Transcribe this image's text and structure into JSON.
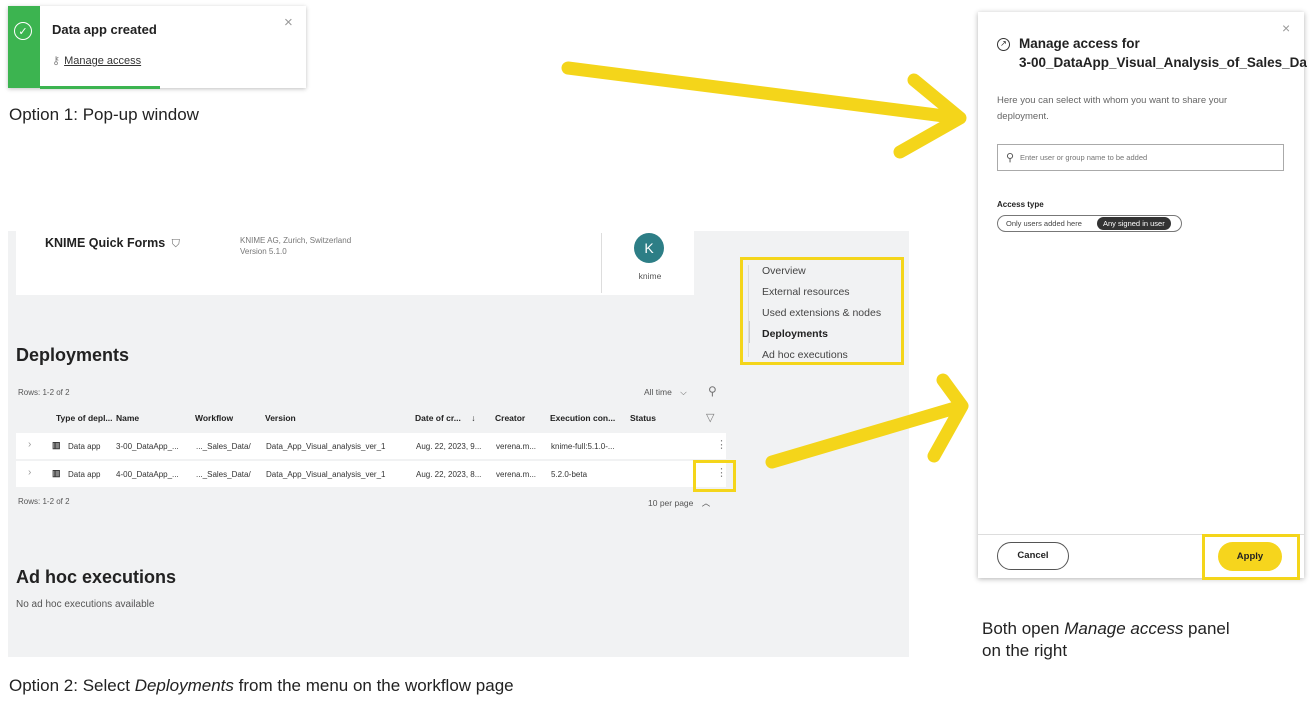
{
  "toast": {
    "title": "Data app created",
    "link": "Manage access",
    "close": "×",
    "success_color": "#3cb450"
  },
  "captions": {
    "option1": "Option 1: Pop-up window",
    "option2_a": "Option 2: Select ",
    "option2_em": "Deployments",
    "option2_b": " from the menu on the workflow page",
    "both_a": "Both open ",
    "both_em": "Manage access",
    "both_b": " panel",
    "both_line2": "on the right"
  },
  "workflow": {
    "title": "KNIME Quick Forms",
    "owner": "KNIME AG, Zurich, Switzerland",
    "version": "Version 5.1.0",
    "avatar_letter": "K",
    "avatar_name": "knime",
    "menu": [
      "Overview",
      "External resources",
      "Used extensions & nodes",
      "Deployments",
      "Ad hoc executions"
    ],
    "deployments": {
      "heading": "Deployments",
      "rows_top": "Rows: 1-2 of 2",
      "rows_bottom": "Rows: 1-2 of 2",
      "time_filter": "All time",
      "per_page": "10 per page",
      "columns": [
        "Type of depl...",
        "Name",
        "Workflow",
        "Version",
        "Date of cr...",
        "Creator",
        "Execution con...",
        "Status"
      ],
      "rows": [
        [
          "Data app",
          "3-00_DataApp_...",
          "..._Sales_Data/",
          "Data_App_Visual_analysis_ver_1",
          "Aug. 22, 2023, 9...",
          "verena.m...",
          "knime-full:5.1.0-...",
          ""
        ],
        [
          "Data app",
          "4-00_DataApp_...",
          "..._Sales_Data/",
          "Data_App_Visual_analysis_ver_1",
          "Aug. 22, 2023, 8...",
          "verena.m...",
          "5.2.0-beta",
          ""
        ]
      ]
    },
    "adhoc": {
      "heading": "Ad hoc executions",
      "empty": "No ad hoc executions available"
    }
  },
  "panel": {
    "title_line1": "Manage access for",
    "title_line2": "3-00_DataApp_Visual_Analysis_of_Sales_Da",
    "description": "Here you can select with whom you want to share your deployment.",
    "search_placeholder": "Enter user or group name to be added",
    "access_type_label": "Access type",
    "access_options": [
      "Only users added here",
      "Any signed in user"
    ],
    "access_selected": "Any signed in user",
    "cancel": "Cancel",
    "apply": "Apply"
  },
  "colors": {
    "highlight": "#f4d51a",
    "apply": "#f6d51d",
    "avatar": "#2d7e86"
  }
}
